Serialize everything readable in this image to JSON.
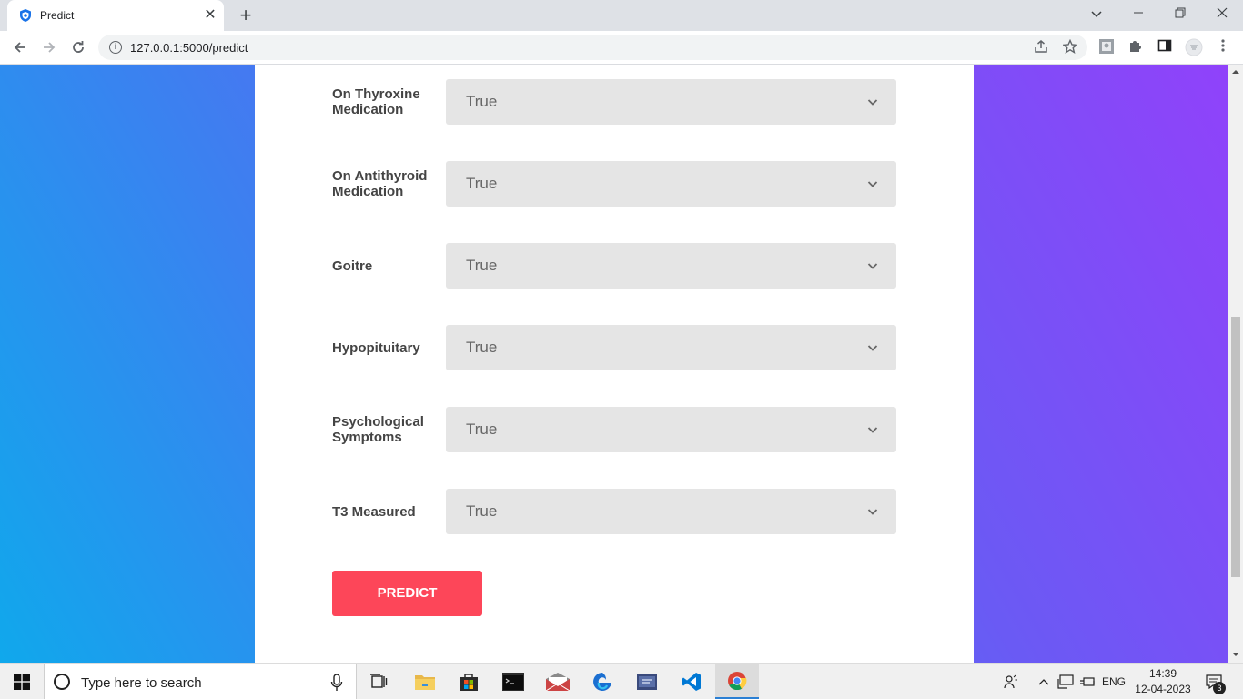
{
  "browser": {
    "tab_title": "Predict",
    "url": "127.0.0.1:5000/predict",
    "new_tab_glyph": "+",
    "tab_close_glyph": "✕"
  },
  "form": {
    "fields": [
      {
        "label": "On Thyroxine Medication",
        "value": "True"
      },
      {
        "label": "On Antithyroid Medication",
        "value": "True"
      },
      {
        "label": "Goitre",
        "value": "True"
      },
      {
        "label": "Hypopituitary",
        "value": "True"
      },
      {
        "label": "Psychological Symptoms",
        "value": "True"
      },
      {
        "label": "T3 Measured",
        "value": "True"
      }
    ],
    "submit_label": "PREDICT"
  },
  "taskbar": {
    "search_placeholder": "Type here to search",
    "language": "ENG",
    "time": "14:39",
    "date": "12-04-2023",
    "notification_count": "3"
  },
  "colors": {
    "accent_button": "#fd4659",
    "select_bg": "#e5e5e5",
    "gradient_left": "#10a8ec",
    "gradient_right": "#9042fa"
  }
}
